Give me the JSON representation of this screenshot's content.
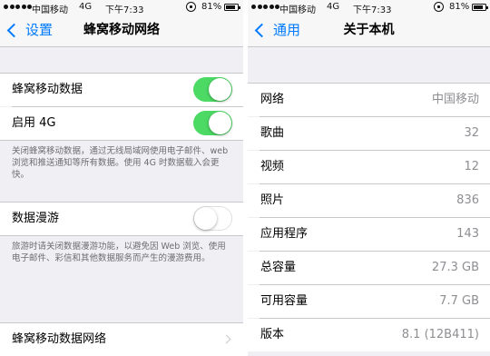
{
  "left": {
    "status": {
      "carrier": "中国移动",
      "network": "4G",
      "time": "下午7:33",
      "battery": "81%"
    },
    "nav": {
      "back_label": "设置",
      "title": "蜂窝移动网络"
    },
    "rows": {
      "cellular_data": "蜂窝移动数据",
      "enable_4g": "启用 4G",
      "data_roaming": "数据漫游",
      "cellular_network": "蜂窝移动数据网络"
    },
    "toggles": {
      "cellular_data": true,
      "enable_4g": true,
      "data_roaming": false
    },
    "notes": {
      "cellular": "关闭蜂窝移动数据，通过无线局域网使用电子邮件、web 浏览和推送通知等所有数据。使用 4G 时数据载入会更快。",
      "roaming": "旅游时请关闭数据漫游功能，以避免因 Web 浏览、使用电子邮件、彩信和其他数据服务而产生的漫游费用。"
    }
  },
  "right": {
    "status": {
      "carrier": "中国移动",
      "network": "4G",
      "time": "下午7:33",
      "battery": "81%"
    },
    "nav": {
      "back_label": "通用",
      "title": "关于本机"
    },
    "rows": [
      {
        "label": "网络",
        "value": "中国移动"
      },
      {
        "label": "歌曲",
        "value": "32"
      },
      {
        "label": "视频",
        "value": "12"
      },
      {
        "label": "照片",
        "value": "836"
      },
      {
        "label": "应用程序",
        "value": "143"
      },
      {
        "label": "总容量",
        "value": "27.3 GB"
      },
      {
        "label": "可用容量",
        "value": "7.7 GB"
      },
      {
        "label": "版本",
        "value": "8.1 (12B411)"
      }
    ]
  },
  "colors": {
    "accent": "#007aff",
    "toggle_on": "#4cd964",
    "background": "#efeff4"
  }
}
